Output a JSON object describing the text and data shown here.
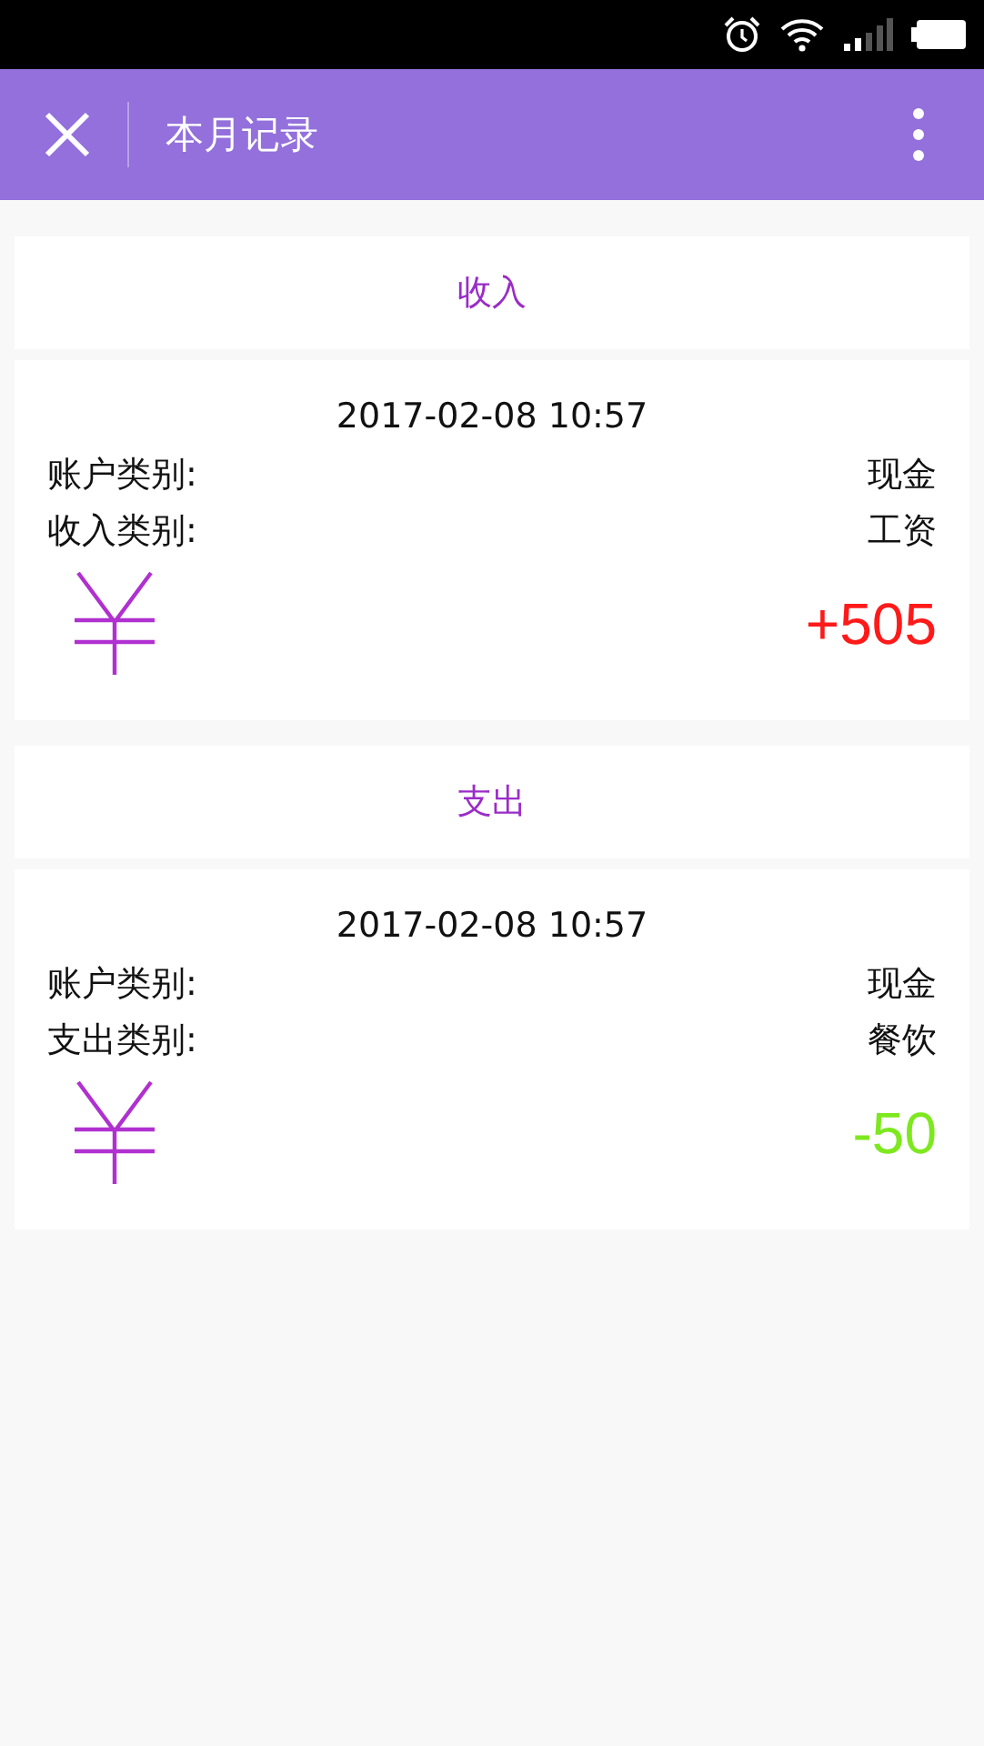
{
  "nav_bar": {
    "title": "本月记录"
  },
  "sections": [
    {
      "kind": "income",
      "heading": "收入",
      "record": {
        "time": "2017-02-08 10:57",
        "rows": [
          {
            "label": "账户类别:",
            "value": "现金"
          },
          {
            "label": "收入类别:",
            "value": "工资"
          }
        ],
        "amount": "+505"
      }
    },
    {
      "kind": "expense",
      "heading": "支出",
      "record": {
        "time": "2017-02-08 10:57",
        "rows": [
          {
            "label": "账户类别:",
            "value": "现金"
          },
          {
            "label": "支出类别:",
            "value": "餐饮"
          }
        ],
        "amount": "-50"
      }
    }
  ]
}
